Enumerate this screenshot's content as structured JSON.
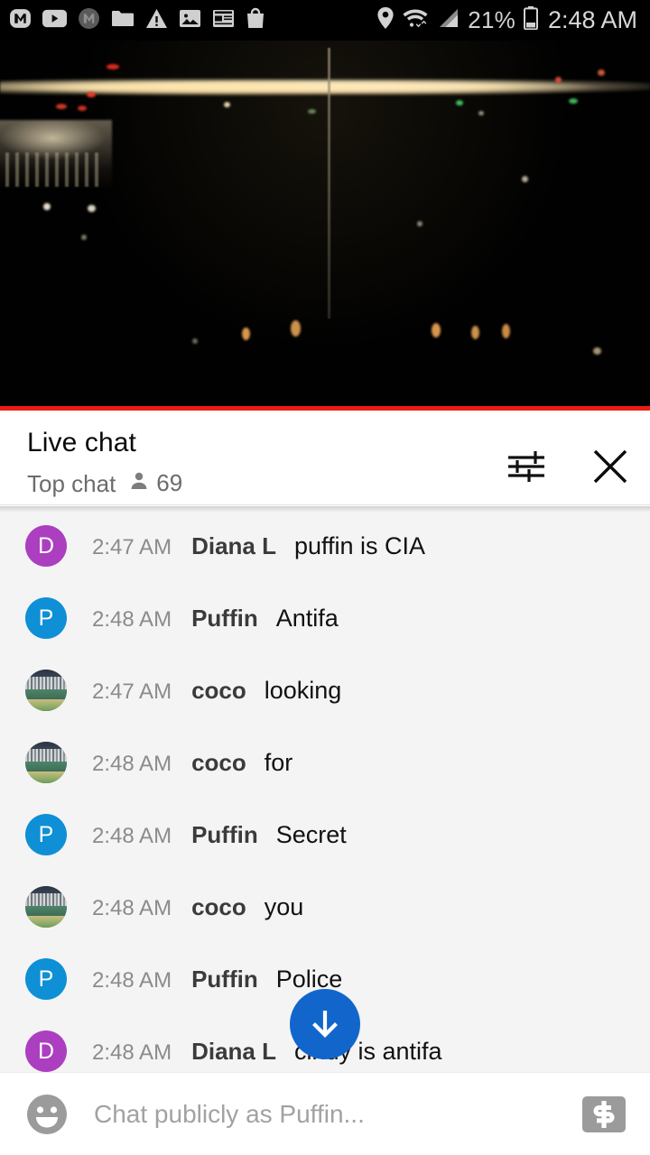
{
  "status_bar": {
    "notification_icons": [
      "m-logo-icon",
      "youtube-icon",
      "m-logo-gray-icon",
      "folder-icon",
      "warning-icon",
      "image-icon",
      "news-icon",
      "shopping-bag-icon"
    ],
    "location_icon": "location-pin-icon",
    "wifi_icon": "wifi-icon",
    "signal_icon": "cell-signal-icon",
    "battery_percent": "21%",
    "battery_icon": "battery-icon",
    "clock": "2:48 AM"
  },
  "video": {
    "scene": "night-cityscape-webcam",
    "progress_percent": 100,
    "progress_color": "#ec1c13"
  },
  "chat_header": {
    "title": "Live chat",
    "subtitle": "Top chat",
    "viewer_icon": "person-icon",
    "viewer_count": "69",
    "settings_icon": "settings-sliders-icon",
    "close_icon": "close-icon"
  },
  "messages": [
    {
      "avatar_type": "letter",
      "avatar_letter": "D",
      "avatar_color": "#ab3fbf",
      "time": "2:47 AM",
      "author": "Diana L",
      "text": "puffin is CIA"
    },
    {
      "avatar_type": "letter",
      "avatar_letter": "P",
      "avatar_color": "#0e8fd6",
      "time": "2:48 AM",
      "author": "Puffin",
      "text": "Antifa"
    },
    {
      "avatar_type": "photo",
      "avatar_letter": "",
      "avatar_color": "#4f6b52",
      "time": "2:47 AM",
      "author": "coco",
      "text": "looking"
    },
    {
      "avatar_type": "photo",
      "avatar_letter": "",
      "avatar_color": "#4f6b52",
      "time": "2:48 AM",
      "author": "coco",
      "text": "for"
    },
    {
      "avatar_type": "letter",
      "avatar_letter": "P",
      "avatar_color": "#0e8fd6",
      "time": "2:48 AM",
      "author": "Puffin",
      "text": "Secret"
    },
    {
      "avatar_type": "photo",
      "avatar_letter": "",
      "avatar_color": "#4f6b52",
      "time": "2:48 AM",
      "author": "coco",
      "text": "you"
    },
    {
      "avatar_type": "letter",
      "avatar_letter": "P",
      "avatar_color": "#0e8fd6",
      "time": "2:48 AM",
      "author": "Puffin",
      "text": "Police"
    },
    {
      "avatar_type": "letter",
      "avatar_letter": "D",
      "avatar_color": "#ab3fbf",
      "time": "2:48 AM",
      "author": "Diana L",
      "text": "cindy is antifa"
    }
  ],
  "scroll_fab": {
    "icon": "arrow-down-icon",
    "color": "#1266cb"
  },
  "input_bar": {
    "emoji_icon": "emoji-smiley-icon",
    "placeholder": "Chat publicly as Puffin...",
    "value": "",
    "super_chat_icon": "super-chat-dollar-icon"
  }
}
